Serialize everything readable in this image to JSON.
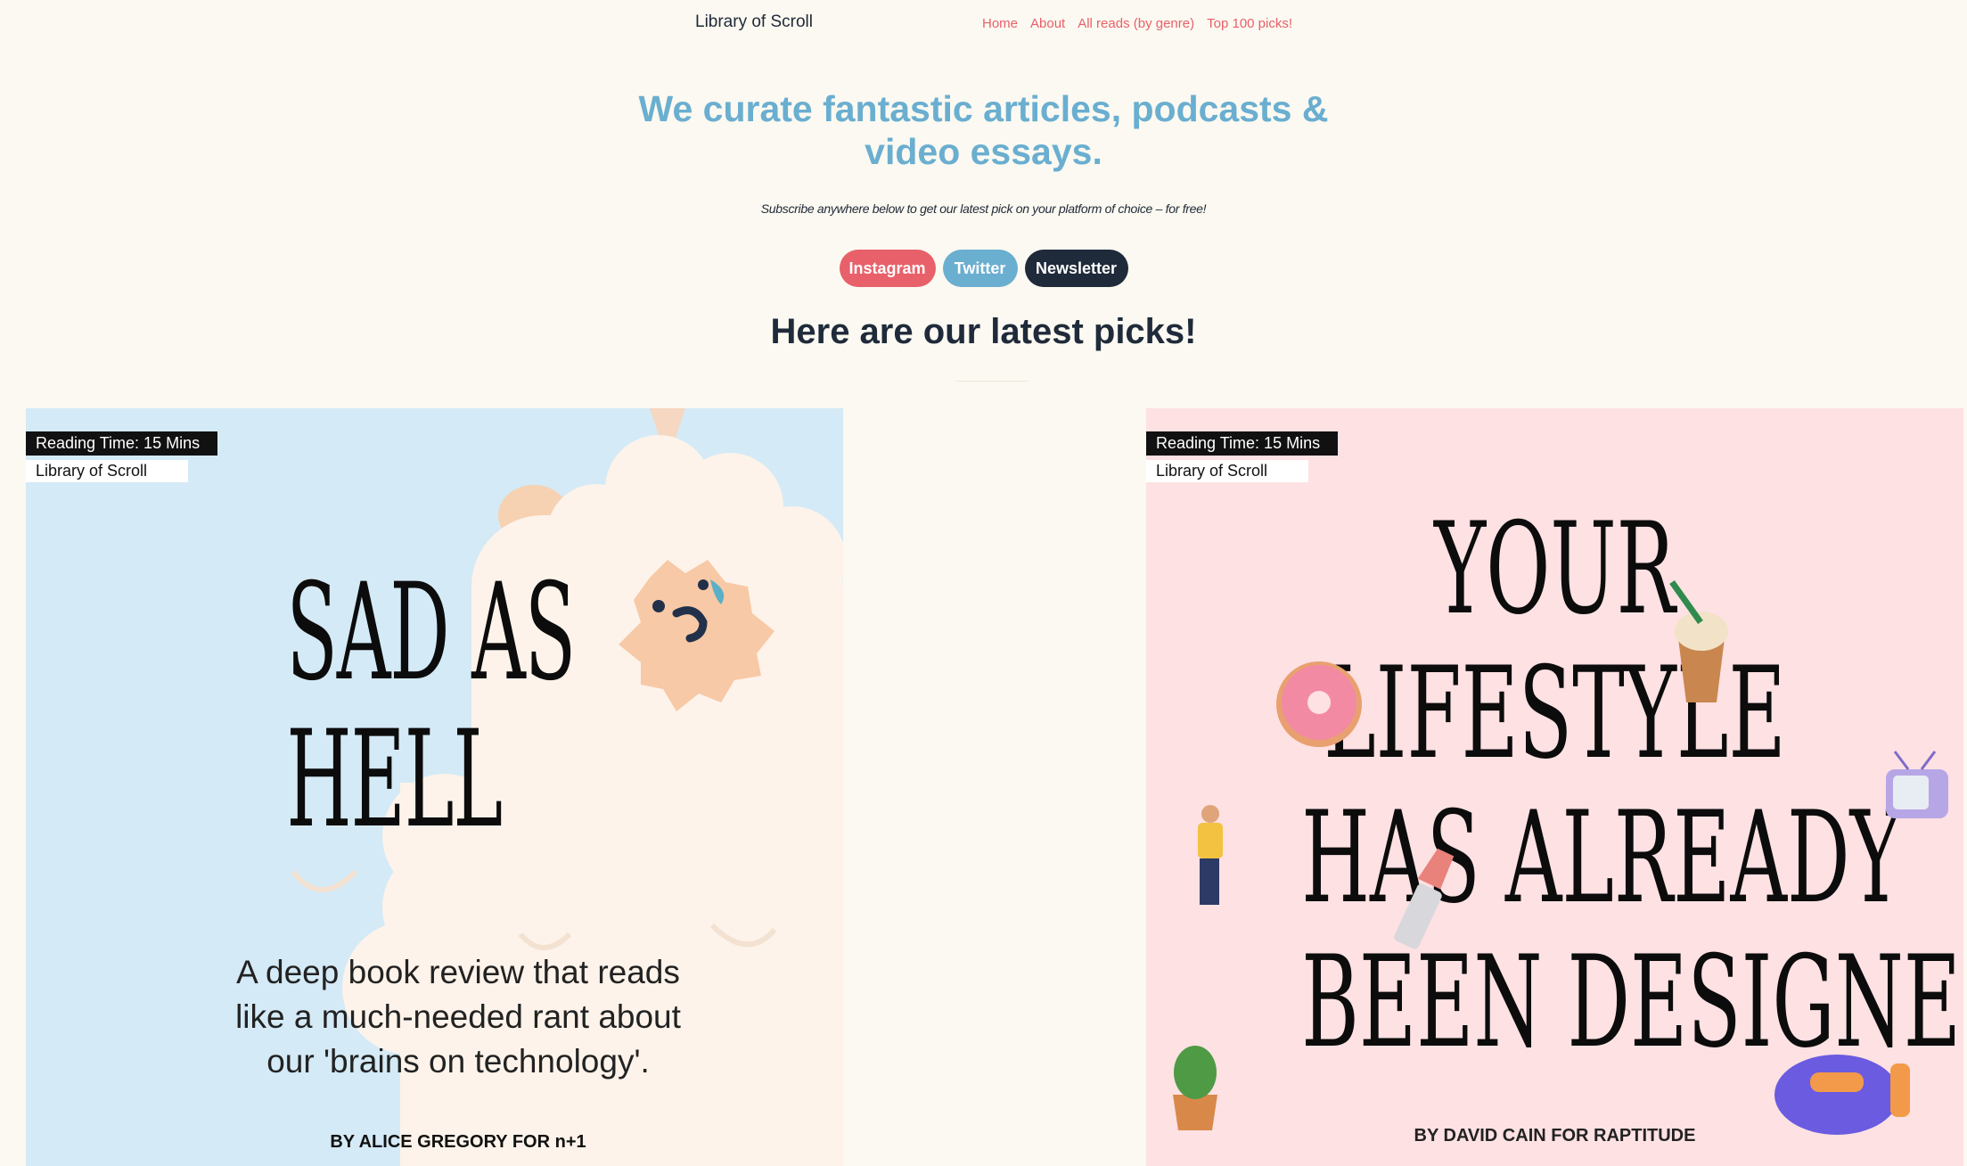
{
  "header": {
    "brand": "Library of Scroll",
    "nav": [
      {
        "label": "Home"
      },
      {
        "label": "About"
      },
      {
        "label": "All reads (by genre)"
      },
      {
        "label": "Top 100 picks!"
      }
    ]
  },
  "hero": {
    "line1": "We curate fantastic articles, podcasts &",
    "line2": "video essays."
  },
  "subscribe": {
    "text": "Subscribe anywhere below to get our latest pick on your platform of choice – for free!"
  },
  "buttons": {
    "instagram": "Instagram",
    "twitter": "Twitter",
    "newsletter": "Newsletter"
  },
  "section": {
    "title": "Here are our latest picks!"
  },
  "cards": [
    {
      "reading_time": "Reading Time: 15 Mins",
      "publisher": "Library of Scroll",
      "title_line1": "SAD AS",
      "title_line2": "HELL",
      "desc_line1": "A deep book review that reads",
      "desc_line2": "like a much-needed rant about",
      "desc_line3": "our 'brains on technology'.",
      "byline": "BY ALICE GREGORY FOR n+1",
      "bg": "#d4eaf6"
    },
    {
      "reading_time": "Reading Time: 15 Mins",
      "publisher": "Library of Scroll",
      "title_line1": "YOUR",
      "title_line2": "LIFESTYLE",
      "title_line3": "HAS ALREADY",
      "title_line4": "BEEN DESIGNED",
      "byline": "BY DAVID CAIN FOR RAPTITUDE",
      "bg": "#fde1e3"
    }
  ],
  "colors": {
    "accent_red": "#e8606a",
    "accent_blue": "#6aaed0",
    "dark": "#1f2a3a",
    "page_bg": "#fbf9f1"
  }
}
